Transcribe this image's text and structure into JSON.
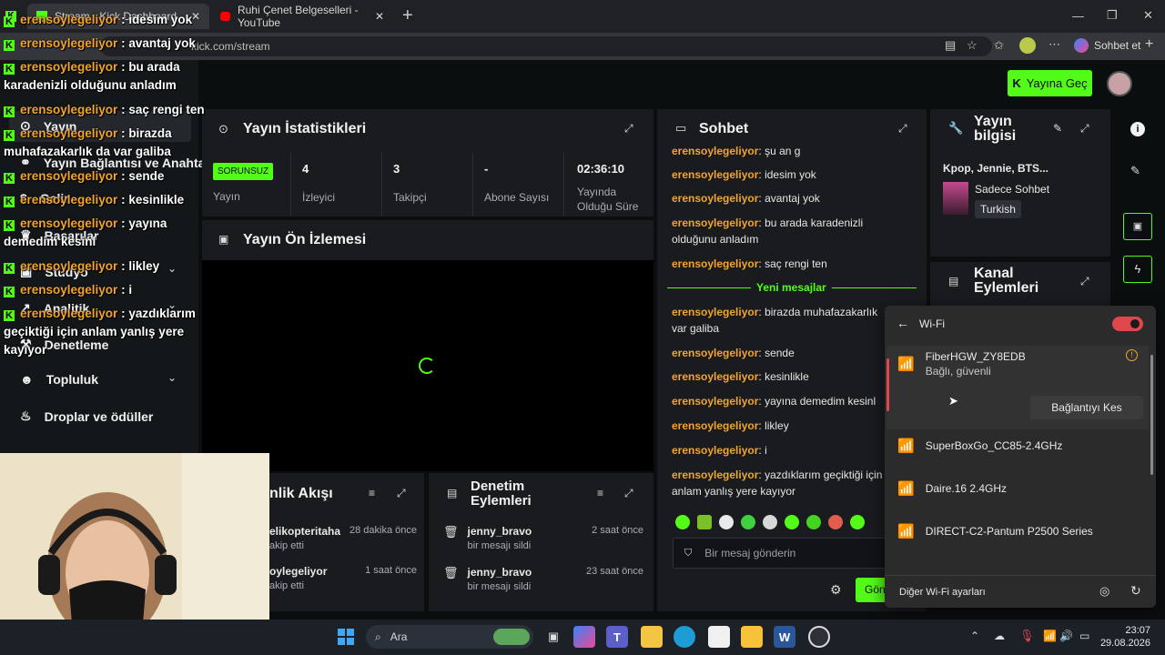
{
  "browser": {
    "tabs": [
      {
        "label": "Stream - Kick Dashboard",
        "active": true
      },
      {
        "label": "Ruhi Çenet Belgeselleri - YouTube",
        "active": false
      }
    ],
    "url": "dashboard.kick.com/stream",
    "url_visible": "kick.com/stream",
    "sohbet_label": "Sohbet et"
  },
  "header": {
    "go_live_label": "Yayına Geç"
  },
  "sidebar": {
    "items": [
      {
        "label": "Yayın",
        "icon": "play-circle-icon"
      },
      {
        "label": "Yayın Bağlantısı ve Anahtar",
        "icon": "link-icon"
      },
      {
        "label": "Gelir",
        "icon": "dollar-icon"
      },
      {
        "label": "Başarılar",
        "icon": "trophy-icon"
      },
      {
        "label": "Stüdyo",
        "icon": "studio-icon"
      },
      {
        "label": "Analitik",
        "icon": "chart-icon"
      },
      {
        "label": "Denetleme",
        "icon": "hammer-icon"
      },
      {
        "label": "Topluluk",
        "icon": "users-icon"
      },
      {
        "label": "Droplar ve ödüller",
        "icon": "gift-icon"
      }
    ]
  },
  "stats": {
    "title": "Yayın İstatistikleri",
    "status_badge": "SORUNSUZ",
    "status_label": "Yayın",
    "cells": [
      {
        "value": "4",
        "label": "İzleyici"
      },
      {
        "value": "3",
        "label": "Takipçi"
      },
      {
        "value": "-",
        "label": "Abone Sayısı"
      },
      {
        "value": "02:36:10",
        "label": "Yayında Olduğu Süre"
      }
    ]
  },
  "preview": {
    "title": "Yayın Ön İzlemesi"
  },
  "activity": {
    "title": "nlik Akışı",
    "items": [
      {
        "name": "elikopteritaha",
        "sub": "akip etti",
        "time": "28 dakika önce"
      },
      {
        "name": "oylegeliyor",
        "sub": "akip etti",
        "time": "1 saat önce"
      }
    ]
  },
  "moderation": {
    "title": "Denetim Eylemleri",
    "items": [
      {
        "name": "jenny_bravo",
        "sub": "bir mesajı sildi",
        "time": "2 saat önce"
      },
      {
        "name": "jenny_bravo",
        "sub": "bir mesajı sildi",
        "time": "23 saat önce"
      }
    ]
  },
  "chat": {
    "title": "Sohbet",
    "username": "erensoylegeliyor",
    "messages_before": [
      "şu an g",
      "idesim yok",
      "avantaj yok",
      "bu arada karadenizli olduğunu anladım",
      "saç rengi ten"
    ],
    "new_divider": "Yeni mesajlar",
    "messages_after": [
      "birazda muhafazakarlık var galiba",
      "sende",
      "kesinlikle",
      "yayına demedim kesinl",
      "likley",
      "i",
      "yazdıklarım geçiktiği için anlam yanlış yere kayıyor"
    ],
    "input_placeholder": "Bir mesaj gönderin",
    "send_label": "Gön"
  },
  "stream_info": {
    "title": "Yayın bilgisi",
    "stream_title": "Kpop, Jennie, BTS...",
    "category": "Sadece Sohbet",
    "language": "Turkish"
  },
  "channel_actions": {
    "title": "Kanal Eylemleri"
  },
  "overlay_chat": [
    {
      "user": "erensoylegeliyor",
      "msg": "idesim yok"
    },
    {
      "user": "erensoylegeliyor",
      "msg": "avantaj yok"
    },
    {
      "user": "erensoylegeliyor",
      "msg": "bu arada karadenizli olduğunu anladım"
    },
    {
      "user": "erensoylegeliyor",
      "msg": "saç rengi ten"
    },
    {
      "user": "erensoylegeliyor",
      "msg": "birazda muhafazakarlık da var galiba"
    },
    {
      "user": "erensoylegeliyor",
      "msg": "sende"
    },
    {
      "user": "erensoylegeliyor",
      "msg": "kesinlikle"
    },
    {
      "user": "erensoylegeliyor",
      "msg": "yayına demedim kesinl"
    },
    {
      "user": "erensoylegeliyor",
      "msg": "likley"
    },
    {
      "user": "erensoylegeliyor",
      "msg": "i"
    },
    {
      "user": "erensoylegeliyor",
      "msg": "yazdıklarım geçiktiği için anlam yanlış yere kayıyor"
    }
  ],
  "wifi": {
    "title": "Wi-Fi",
    "enabled": true,
    "networks": [
      {
        "name": "FiberHGW_ZY8EDB",
        "status": "Bağlı, güvenli",
        "connected": true
      },
      {
        "name": "SuperBoxGo_CC85-2.4GHz",
        "status": ""
      },
      {
        "name": "Daire.16 2.4GHz",
        "status": ""
      },
      {
        "name": "DIRECT-C2-Pantum P2500 Series",
        "status": ""
      }
    ],
    "disconnect_label": "Bağlantıyı Kes",
    "more_settings_label": "Diğer Wi-Fi ayarları"
  },
  "taskbar": {
    "search_label": "Ara",
    "time": "23:07",
    "date": "29.08.2026"
  },
  "colors": {
    "kick_green": "#53fc18",
    "username_orange": "#f2a52c",
    "wifi_toggle": "#e0474c"
  }
}
